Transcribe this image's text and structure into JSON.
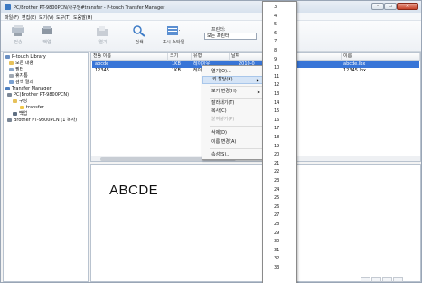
{
  "window": {
    "title": "PC/Brother PT-9800PCN/사구엉#transfer - P-touch Transfer Manager",
    "controls": {
      "minimize": "-",
      "maximize": "▭",
      "close": "✕"
    }
  },
  "menubar": [
    "파일(F)",
    "편집(E)",
    "보기(V)",
    "도구(T)",
    "도움말(H)"
  ],
  "toolbar": {
    "items": [
      {
        "label": "전송",
        "icon": "transfer-icon",
        "enabled": false
      },
      {
        "label": "백업",
        "icon": "backup-icon",
        "enabled": false
      },
      {
        "label": "열기",
        "icon": "open-folder-icon",
        "enabled": false
      },
      {
        "label": "검색",
        "icon": "search-icon",
        "enabled": true
      },
      {
        "label": "표시 스타일",
        "icon": "display-style-icon",
        "enabled": true
      }
    ],
    "printer_label": "프린터:",
    "printer_value": "모든 프린터"
  },
  "tree": [
    "P-touch Library",
    "모든 내용",
    "필터",
    "휴지통",
    "검색 결과",
    "Transfer Manager",
    "PC(Brother PT-9800PCN)",
    "구성",
    "transfer",
    "백업",
    "Brother PT-9800PCN (1 복사)"
  ],
  "list": {
    "columns": [
      "전송 이름",
      "크기",
      "유형",
      "날짜",
      "이름"
    ],
    "rows": [
      {
        "name": "abcde",
        "size": "1KB",
        "type": "레이아웃",
        "date": "2010-0",
        "file": "abcde.lbx",
        "selected": true
      },
      {
        "name": "12345",
        "size": "1KB",
        "type": "레이",
        "date": "",
        "file": "12345.lbx",
        "selected": false
      }
    ]
  },
  "context_menu": {
    "items": [
      {
        "label": "열기(O)...",
        "enabled": true,
        "submenu": false
      },
      {
        "label": "키 할당(K)",
        "enabled": true,
        "submenu": true,
        "highlighted": true
      },
      {
        "label": "보기 변경(H)",
        "enabled": true,
        "submenu": true
      },
      {
        "label": "잘라내기(T)",
        "enabled": true,
        "submenu": false
      },
      {
        "label": "복사(C)",
        "enabled": true,
        "submenu": false
      },
      {
        "label": "붙여넣기(P)",
        "enabled": false,
        "submenu": false
      },
      {
        "label": "삭제(D)",
        "enabled": true,
        "submenu": false
      },
      {
        "label": "이름 변경(A)",
        "enabled": true,
        "submenu": false
      },
      {
        "label": "속성(S)...",
        "enabled": true,
        "submenu": false
      }
    ]
  },
  "key_dropdown": {
    "items": [
      "3",
      "4",
      "5",
      "6",
      "7",
      "8",
      "9",
      "10",
      "11",
      "12",
      "13",
      "14",
      "15",
      "16",
      "17",
      "18",
      "19",
      "20",
      "21",
      "22",
      "23",
      "24",
      "25",
      "26",
      "27",
      "28",
      "29",
      "30",
      "31",
      "32",
      "33"
    ]
  },
  "preview": {
    "text": "ABCDE"
  }
}
